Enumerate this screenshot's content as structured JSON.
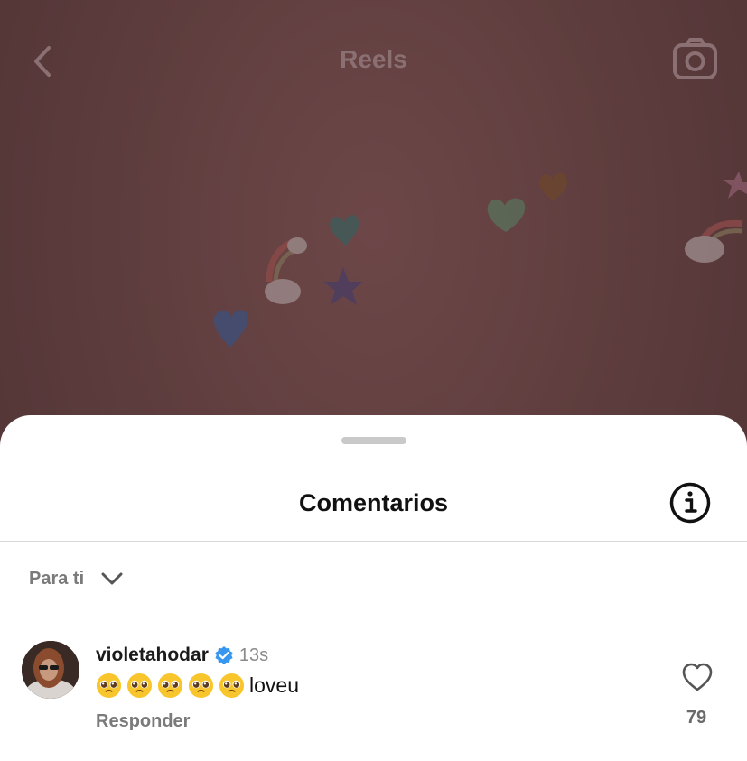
{
  "header": {
    "title": "Reels",
    "back_icon": "chevron-left-icon",
    "camera_icon": "camera-icon"
  },
  "sheet": {
    "title": "Comentarios",
    "info_icon": "info-icon"
  },
  "filter": {
    "label": "Para ti",
    "icon": "chevron-down-icon"
  },
  "comments": [
    {
      "username": "violetahodar",
      "verified": true,
      "time": "13s",
      "emoji_count": 5,
      "emoji_name": "pleading-face",
      "text_suffix": "loveu",
      "reply_label": "Responder",
      "like_count": "79"
    }
  ],
  "colors": {
    "background_dim": "#5e3d3e",
    "sheet": "#ffffff",
    "verified_blue": "#3797f0"
  }
}
